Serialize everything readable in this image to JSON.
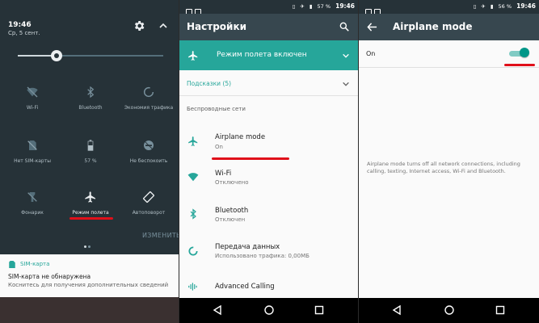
{
  "colors": {
    "teal": "#26a69a",
    "toolbar": "#37474f",
    "status_bar": "#263238",
    "red_underline": "#e0101a"
  },
  "quick_settings": {
    "time": "19:46",
    "date": "Ср, 5 сент.",
    "tiles": [
      {
        "label": "Wi-Fi",
        "icon": "wifi-off-icon"
      },
      {
        "label": "Bluetooth",
        "icon": "bluetooth-icon"
      },
      {
        "label": "Экономия трафика",
        "icon": "data-saver-icon"
      },
      {
        "label": "Нет SIM-карты",
        "icon": "no-sim-icon"
      },
      {
        "label": "57 %",
        "icon": "battery-icon"
      },
      {
        "label": "Не беспокоить",
        "icon": "do-not-disturb-icon"
      },
      {
        "label": "Фонарик",
        "icon": "flashlight-icon"
      },
      {
        "label": "Режим полета",
        "icon": "airplane-icon",
        "active": true
      },
      {
        "label": "Автоповорот",
        "icon": "auto-rotate-icon"
      }
    ],
    "edit_label": "ИЗМЕНИТЬ",
    "notification": {
      "app": "SIM-карта",
      "title": "SIM-карта не обнаружена",
      "text": "Коснитесь для получения дополнительных сведений"
    }
  },
  "settings": {
    "status_time": "19:46",
    "battery": "57 %",
    "title": "Настройки",
    "banner": "Режим полета включен",
    "hints": "Подсказки (5)",
    "section": "Беспроводные сети",
    "items": [
      {
        "title": "Airplane mode",
        "subtitle": "On",
        "icon": "airplane-icon"
      },
      {
        "title": "Wi-Fi",
        "subtitle": "Отключено",
        "icon": "wifi-icon"
      },
      {
        "title": "Bluetooth",
        "subtitle": "Отключен",
        "icon": "bluetooth-icon"
      },
      {
        "title": "Передача данных",
        "subtitle": "Использовано трафика: 0,00МБ",
        "icon": "data-usage-icon"
      },
      {
        "title": "Advanced Calling",
        "subtitle": "",
        "icon": "advanced-calling-icon"
      }
    ]
  },
  "airplane_mode": {
    "status_time": "19:46",
    "battery": "56 %",
    "title": "Airplane mode",
    "switch_label": "On",
    "switch_on": true,
    "description": "Airplane mode turns off all network connections, including calling, texting, Internet access, Wi-Fi and Bluetooth."
  }
}
